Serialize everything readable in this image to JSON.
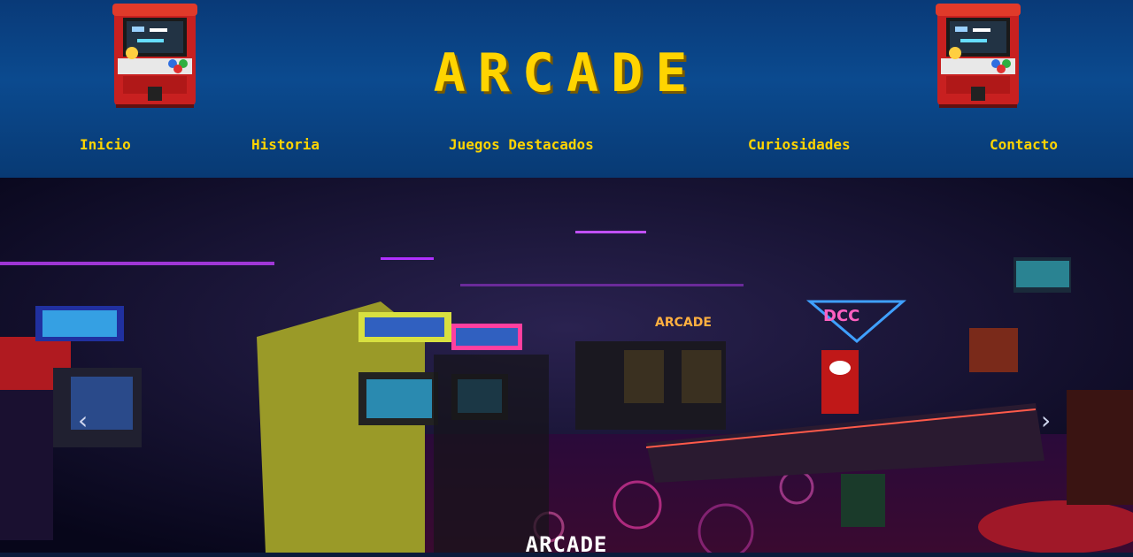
{
  "header": {
    "title": "ARCADE",
    "accent_color": "#ffd400",
    "background_color": "#0b4a8f",
    "logo_icon": "arcade-cabinet-icon"
  },
  "nav": {
    "items": [
      {
        "label": "Inicio"
      },
      {
        "label": "Historia"
      },
      {
        "label": "Juegos Destacados"
      },
      {
        "label": "Curiosidades"
      },
      {
        "label": "Contacto"
      }
    ]
  },
  "carousel": {
    "caption": "ARCADE",
    "prev_icon": "chevron-left-icon",
    "next_icon": "chevron-right-icon"
  }
}
